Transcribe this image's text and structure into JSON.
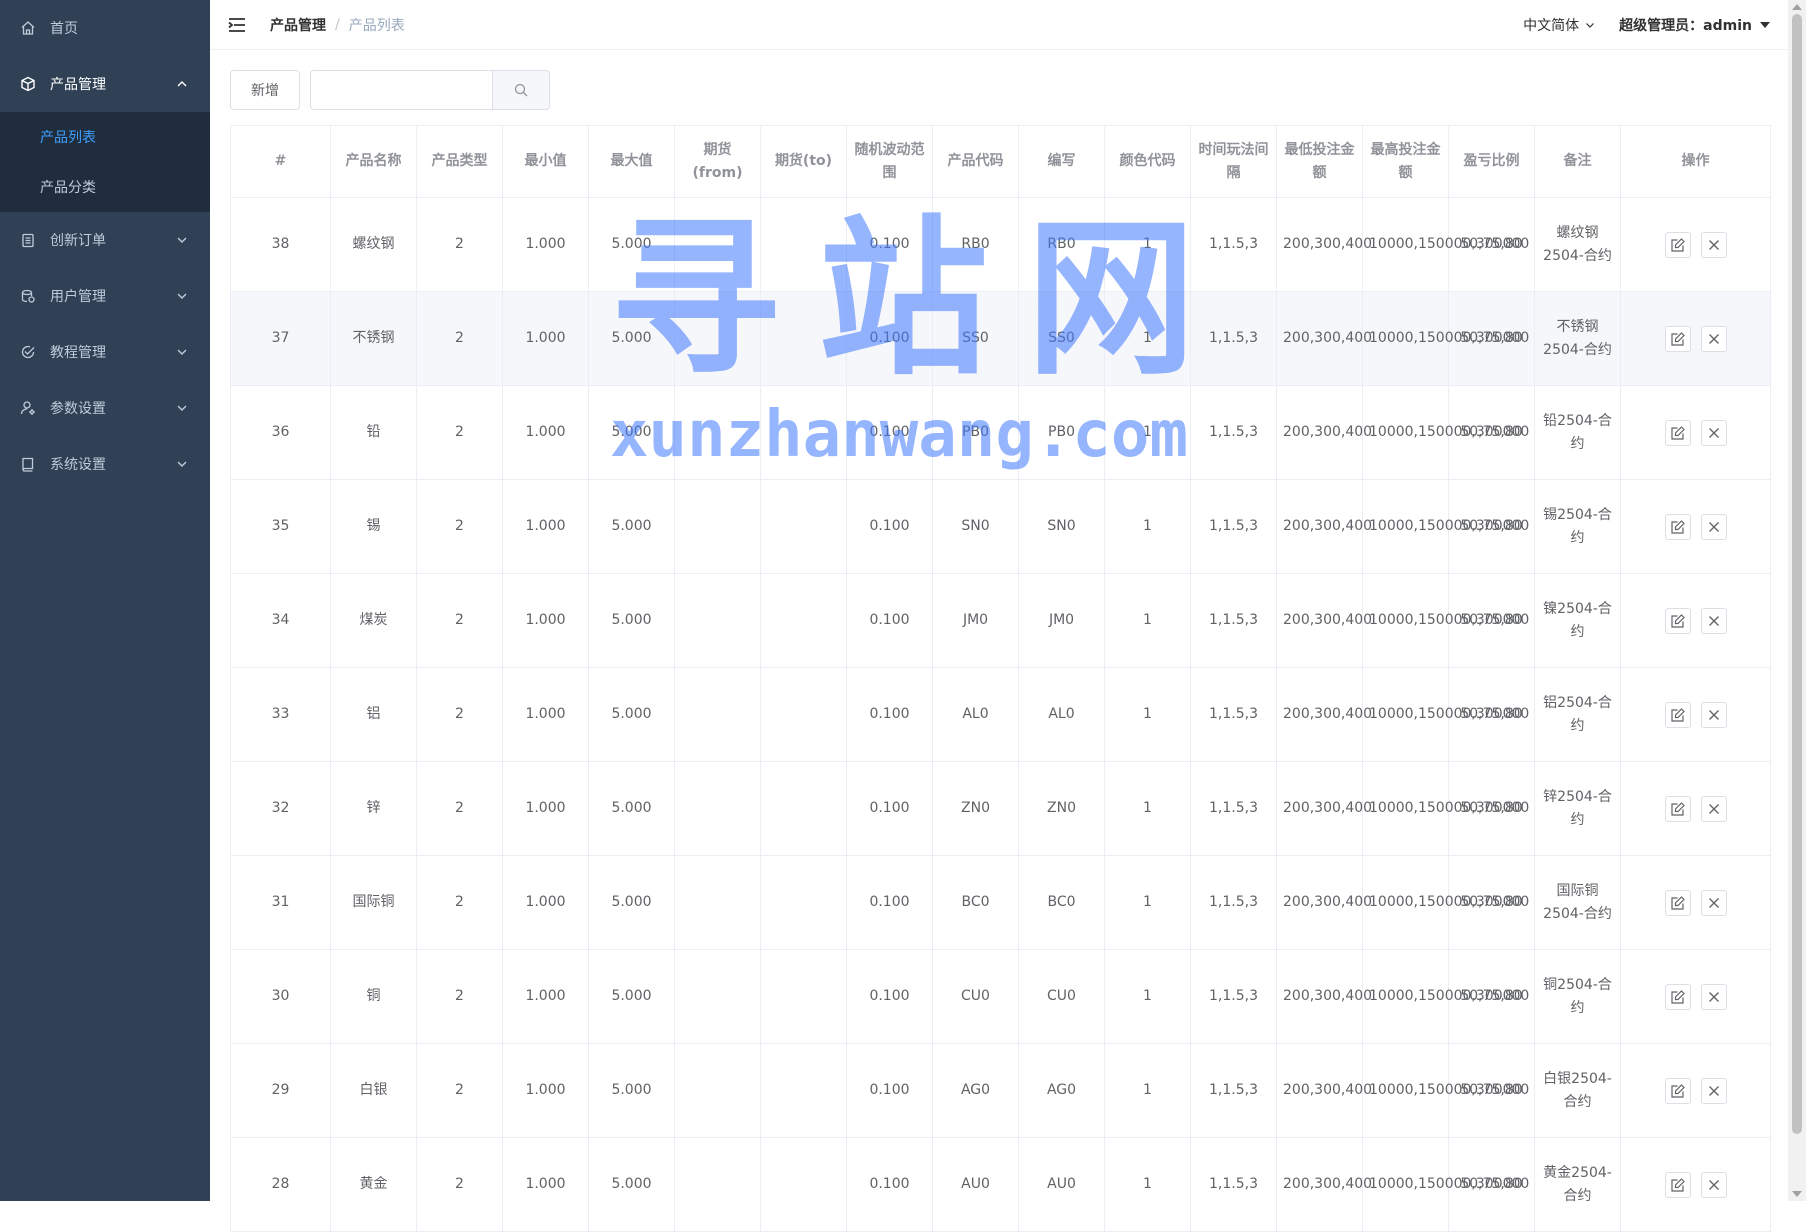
{
  "sidebar": {
    "items": [
      {
        "label": "首页",
        "icon": "home-icon"
      },
      {
        "label": "产品管理",
        "icon": "cube-icon",
        "open": true,
        "children": [
          {
            "label": "产品列表",
            "active": true
          },
          {
            "label": "产品分类"
          }
        ]
      },
      {
        "label": "创新订单",
        "icon": "clipboard-icon"
      },
      {
        "label": "用户管理",
        "icon": "users-icon"
      },
      {
        "label": "教程管理",
        "icon": "check-circle-icon"
      },
      {
        "label": "参数设置",
        "icon": "user-settings-icon"
      },
      {
        "label": "系统设置",
        "icon": "book-icon"
      }
    ]
  },
  "navbar": {
    "breadcrumb": [
      "产品管理",
      "产品列表"
    ],
    "language": "中文简体",
    "user": "超级管理员：admin"
  },
  "toolbar": {
    "add_label": "新增",
    "search_placeholder": ""
  },
  "table": {
    "headers": [
      "#",
      "产品名称",
      "产品类型",
      "最小值",
      "最大值",
      "期货(from)",
      "期货(to)",
      "随机波动范围",
      "产品代码",
      "编写",
      "颜色代码",
      "时间玩法间隔",
      "最低投注金额",
      "最高投注金额",
      "盈亏比例",
      "备注",
      "操作"
    ],
    "rows": [
      [
        "38",
        "螺纹钢",
        "2",
        "1.000",
        "5.000",
        "",
        "",
        "0.100",
        "RB0",
        "RB0",
        "1",
        "1,1.5,3",
        "200,300,400",
        "10000,150000,300000",
        "50,75,80",
        "螺纹钢2504-合约"
      ],
      [
        "37",
        "不锈钢",
        "2",
        "1.000",
        "5.000",
        "",
        "",
        "0.100",
        "SS0",
        "SS0",
        "1",
        "1,1.5,3",
        "200,300,400",
        "10000,150000,300000",
        "50,75,80",
        "不锈钢2504-合约"
      ],
      [
        "36",
        "铅",
        "2",
        "1.000",
        "5.000",
        "",
        "",
        "0.100",
        "PB0",
        "PB0",
        "1",
        "1,1.5,3",
        "200,300,400",
        "10000,150000,300000",
        "50,75,80",
        "铅2504-合约"
      ],
      [
        "35",
        "锡",
        "2",
        "1.000",
        "5.000",
        "",
        "",
        "0.100",
        "SN0",
        "SN0",
        "1",
        "1,1.5,3",
        "200,300,400",
        "10000,150000,300000",
        "50,75,80",
        "锡2504-合约"
      ],
      [
        "34",
        "煤炭",
        "2",
        "1.000",
        "5.000",
        "",
        "",
        "0.100",
        "JM0",
        "JM0",
        "1",
        "1,1.5,3",
        "200,300,400",
        "10000,150000,300000",
        "50,75,80",
        "镍2504-合约"
      ],
      [
        "33",
        "铝",
        "2",
        "1.000",
        "5.000",
        "",
        "",
        "0.100",
        "AL0",
        "AL0",
        "1",
        "1,1.5,3",
        "200,300,400",
        "10000,150000,300000",
        "50,75,80",
        "铝2504-合约"
      ],
      [
        "32",
        "锌",
        "2",
        "1.000",
        "5.000",
        "",
        "",
        "0.100",
        "ZN0",
        "ZN0",
        "1",
        "1,1.5,3",
        "200,300,400",
        "10000,150000,300000",
        "50,75,80",
        "锌2504-合约"
      ],
      [
        "31",
        "国际铜",
        "2",
        "1.000",
        "5.000",
        "",
        "",
        "0.100",
        "BC0",
        "BC0",
        "1",
        "1,1.5,3",
        "200,300,400",
        "10000,150000,300000",
        "50,75,80",
        "国际铜2504-合约"
      ],
      [
        "30",
        "铜",
        "2",
        "1.000",
        "5.000",
        "",
        "",
        "0.100",
        "CU0",
        "CU0",
        "1",
        "1,1.5,3",
        "200,300,400",
        "10000,150000,300000",
        "50,75,80",
        "铜2504-合约"
      ],
      [
        "29",
        "白银",
        "2",
        "1.000",
        "5.000",
        "",
        "",
        "0.100",
        "AG0",
        "AG0",
        "1",
        "1,1.5,3",
        "200,300,400",
        "10000,150000,300000",
        "50,75,80",
        "白银2504-合约"
      ],
      [
        "28",
        "黄金",
        "2",
        "1.000",
        "5.000",
        "",
        "",
        "0.100",
        "AU0",
        "AU0",
        "1",
        "1,1.5,3",
        "200,300,400",
        "10000,150000,300000",
        "50,75,80",
        "黄金2504-合约"
      ]
    ],
    "row_actions": [
      "edit-icon",
      "close-icon"
    ]
  },
  "watermark": {
    "cn": "寻站网",
    "en": "xunzhanwang.com"
  },
  "colors": {
    "sidebar_bg": "#304156",
    "submenu_bg": "#1f2d3d",
    "active": "#409eff",
    "watermark": "#4078ff"
  }
}
